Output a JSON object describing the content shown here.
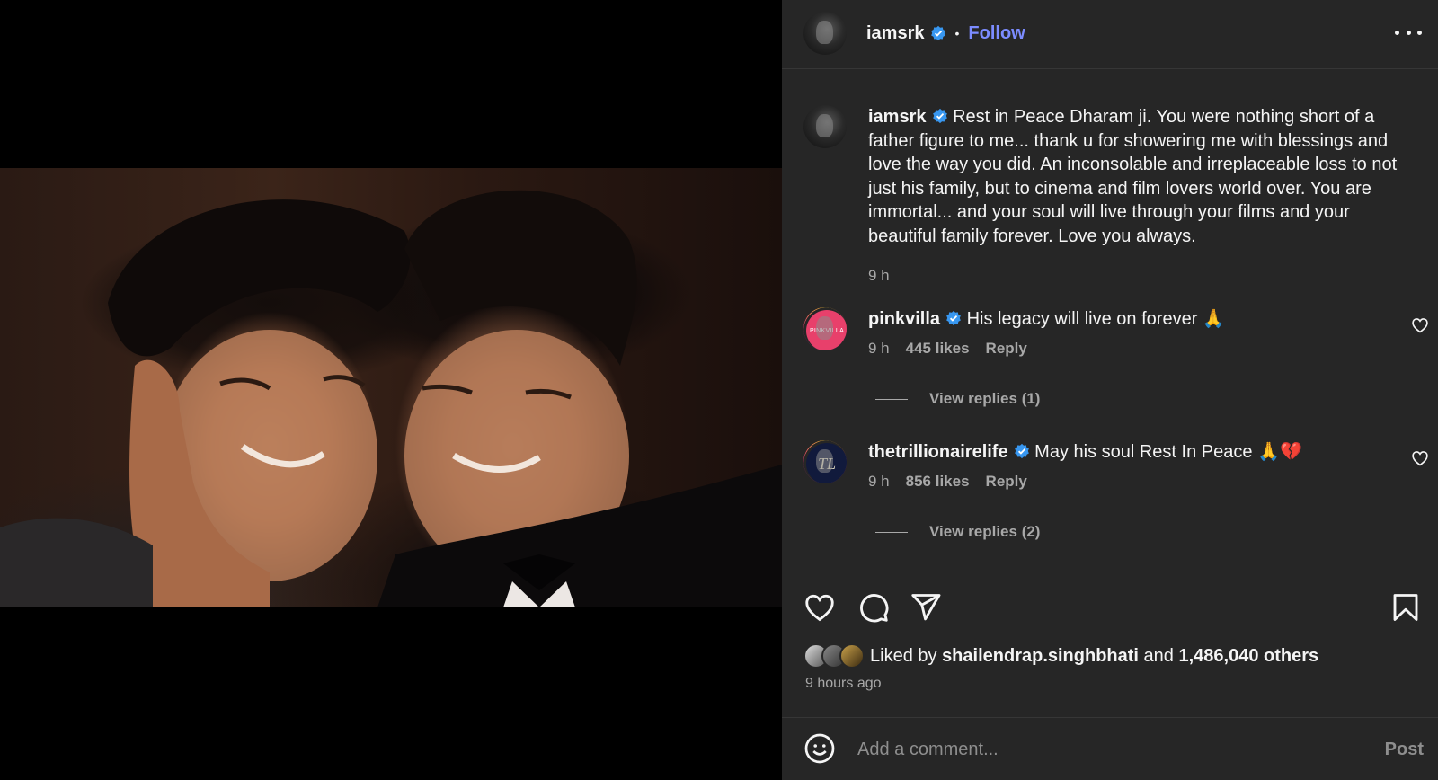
{
  "header": {
    "username": "iamsrk",
    "separator": "•",
    "follow_label": "Follow"
  },
  "caption": {
    "username": "iamsrk",
    "text": "Rest in Peace Dharam ji. You were nothing short of a father figure to me... thank u for showering me with blessings and love the way you did. An inconsolable and irreplaceable loss to not just his family, but to cinema and film lovers world over. You are immortal... and your soul will live through your films and your beautiful family forever. Love you always.",
    "time": "9 h"
  },
  "comments": [
    {
      "username": "pinkvilla",
      "avatar_text": "PINKVILLA",
      "text": "His legacy will live on forever 🙏",
      "time": "9 h",
      "likes": "445 likes",
      "reply_label": "Reply",
      "view_replies": "View replies (1)"
    },
    {
      "username": "thetrillionairelife",
      "avatar_text": "TL",
      "text": "May his soul Rest In Peace 🙏💔",
      "time": "9 h",
      "likes": "856 likes",
      "reply_label": "Reply",
      "view_replies": "View replies (2)"
    }
  ],
  "likes": {
    "prefix": "Liked by",
    "user": "shailendrap.singhbhati",
    "and": "and",
    "others": "1,486,040 others",
    "posted": "9 hours ago"
  },
  "comment_box": {
    "placeholder": "Add a comment...",
    "post_label": "Post"
  },
  "icons": {
    "verified": "verified-badge-icon",
    "more": "more-options-icon",
    "like": "heart-icon",
    "comment": "comment-icon",
    "share": "send-icon",
    "save": "bookmark-icon",
    "emoji": "emoji-icon"
  },
  "colors": {
    "panel_bg": "#262626",
    "follow": "#7c8cff",
    "verified": "#3897f0",
    "muted": "#a8a8a8"
  }
}
